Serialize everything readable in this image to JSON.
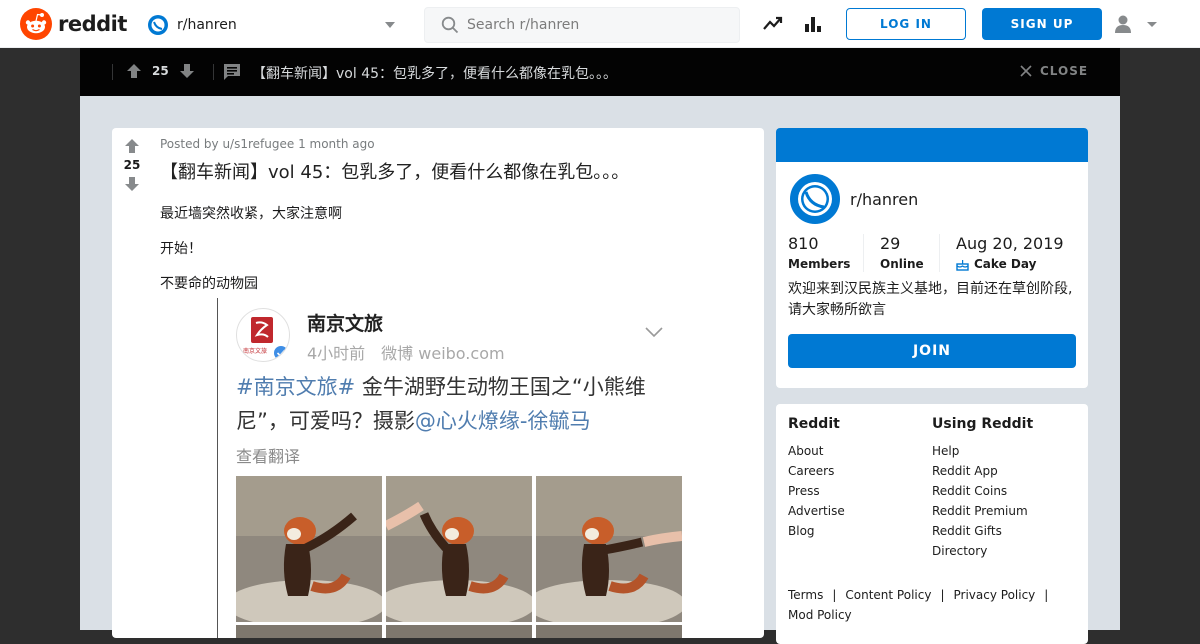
{
  "header": {
    "logo_text": "reddit",
    "community": "r/hanren",
    "search_placeholder": "Search r/hanren",
    "login_label": "LOG IN",
    "signup_label": "SIGN UP",
    "brand_color": "#FF4500",
    "accent_color": "#0079D3"
  },
  "post_bar": {
    "score": "25",
    "title": "【翻车新闻】vol 45：包乳多了，便看什么都像在乳包。。。",
    "close_label": "CLOSE"
  },
  "post": {
    "meta": "Posted by u/s1refugee 1 month ago",
    "score": "25",
    "title": "【翻车新闻】vol 45：包乳多了，便看什么都像在乳包。。。",
    "paragraphs": [
      "最近墙突然收紧，大家注意啊",
      "开始！",
      "不要命的动物园"
    ],
    "embed": {
      "account": "南京文旅",
      "avatar_text": "南京文旅",
      "time_source": "4小时前　微博 weibo.com",
      "tag": "#南京文旅#",
      "text_1": " 金牛湖野生动物王国之“小熊维",
      "text_2": "尼”，可爱吗？摄影",
      "mention": "@心火燎缘-徐毓马",
      "translate": "查看翻译"
    }
  },
  "community_card": {
    "name": "r/hanren",
    "members_value": "810",
    "members_label": "Members",
    "online_value": "29",
    "online_label": "Online",
    "created_value": "Aug 20, 2019",
    "created_label": "Cake Day",
    "description": "欢迎来到汉民族主义基地，目前还在草创阶段,请大家畅所欲言",
    "join_label": "JOIN"
  },
  "footer": {
    "col1": {
      "heading": "Reddit",
      "links": [
        "About",
        "Careers",
        "Press",
        "Advertise",
        "Blog"
      ]
    },
    "col2": {
      "heading": "Using Reddit",
      "links": [
        "Help",
        "Reddit App",
        "Reddit Coins",
        "Reddit Premium",
        "Reddit Gifts",
        "Directory"
      ]
    },
    "legal": [
      "Terms",
      "Content Policy",
      "Privacy Policy",
      "Mod Policy"
    ]
  }
}
